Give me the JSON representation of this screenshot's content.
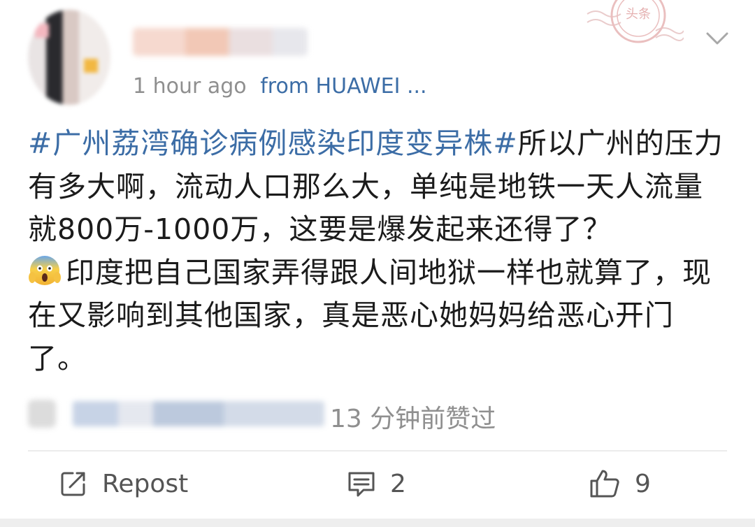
{
  "post": {
    "time": "1 hour ago",
    "source": "from HUAWEI ...",
    "stamp_text": "头条",
    "hashtag": "#广州荔湾确诊病例感染印度变异株#",
    "text_part1": "所以广州的压力有多大啊，流动人口那么大，单纯是地铁一天人流量就800万-1000万，这要是爆发起来还得了？",
    "text_part2": "印度把自己国家弄得跟人间地狱一样也就算了，现在又影响到其他国家，真是恶心她妈妈给恶心开门了。",
    "emoji": "screaming-face"
  },
  "likes": {
    "liked_text": "13 分钟前赞过"
  },
  "actions": {
    "repost_label": "Repost",
    "comment_count": "2",
    "like_count": "9"
  },
  "colors": {
    "link": "#3c6da6",
    "meta": "#8f8f8f",
    "text": "#1b1b1b"
  }
}
